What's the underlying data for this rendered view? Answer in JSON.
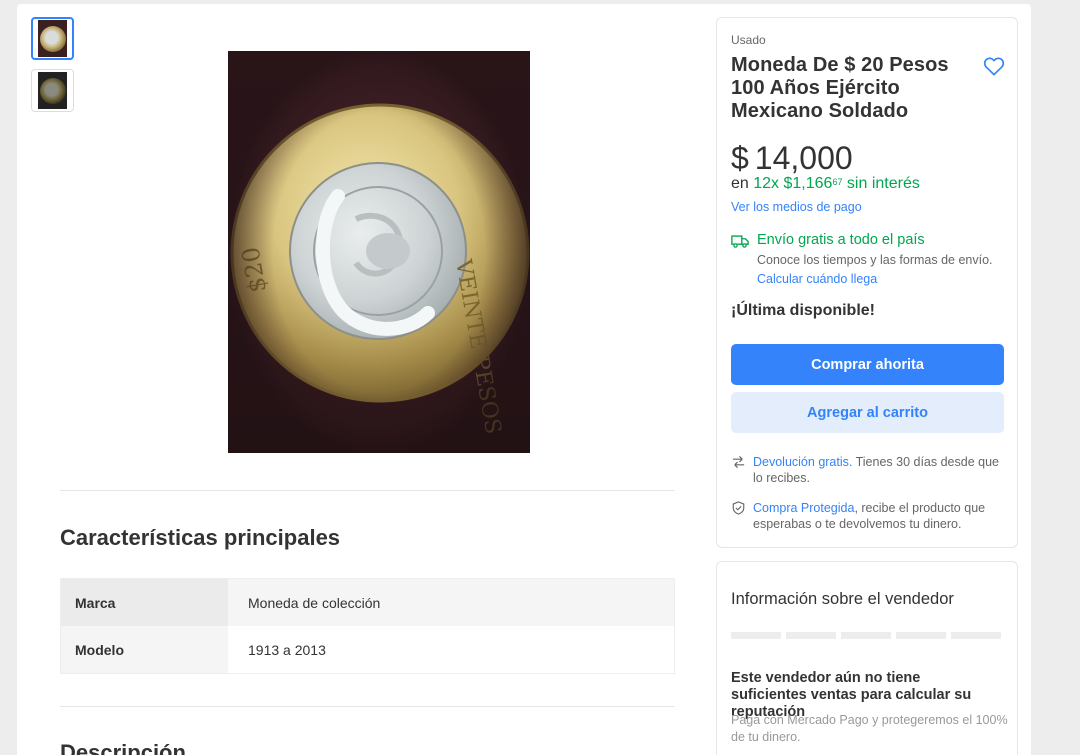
{
  "gallery": {
    "thumbnails": [
      "thumbnail-1",
      "thumbnail-2"
    ],
    "active_index": 0
  },
  "product": {
    "condition": "Usado",
    "title": "Moneda De $ 20 Pesos 100 Años Ejército Mexicano Soldado",
    "price": {
      "currency": "$",
      "amount": "14,000"
    },
    "installments": {
      "prefix": "en",
      "count": "12x",
      "currency": "$",
      "amount": "1,166",
      "cents": "67",
      "suffix": "sin interés"
    },
    "payment_link": "Ver los medios de pago",
    "shipping": {
      "title": "Envío gratis a todo el país",
      "subtitle": "Conoce los tiempos y las formas de envío.",
      "link": "Calcular cuándo llega"
    },
    "stock_notice": "¡Última disponible!",
    "buy_button": "Comprar ahorita",
    "cart_button": "Agregar al carrito",
    "return_policy": {
      "link": "Devolución gratis.",
      "text": " Tienes 30 días desde que lo recibes."
    },
    "protected_purchase": {
      "link": "Compra Protegida",
      "text": ", recibe el producto que esperabas o te devolvemos tu dinero."
    }
  },
  "specs": {
    "title": "Características principales",
    "rows": [
      {
        "key": "Marca",
        "value": "Moneda de colección"
      },
      {
        "key": "Modelo",
        "value": "1913 a 2013"
      }
    ]
  },
  "description": {
    "title": "Descripción"
  },
  "seller": {
    "title": "Información sobre el vendedor",
    "reputation_note": "Este vendedor aún no tiene suficientes ventas para calcular su reputación",
    "protection_note": "Paga con Mercado Pago y protegeremos el 100% de tu dinero."
  },
  "colors": {
    "accent": "#3483fa",
    "green": "#00a650",
    "secondary_button_bg": "#e3edfb"
  },
  "icons": [
    "heart-icon",
    "truck-icon",
    "return-arrow-icon",
    "shield-check-icon"
  ]
}
